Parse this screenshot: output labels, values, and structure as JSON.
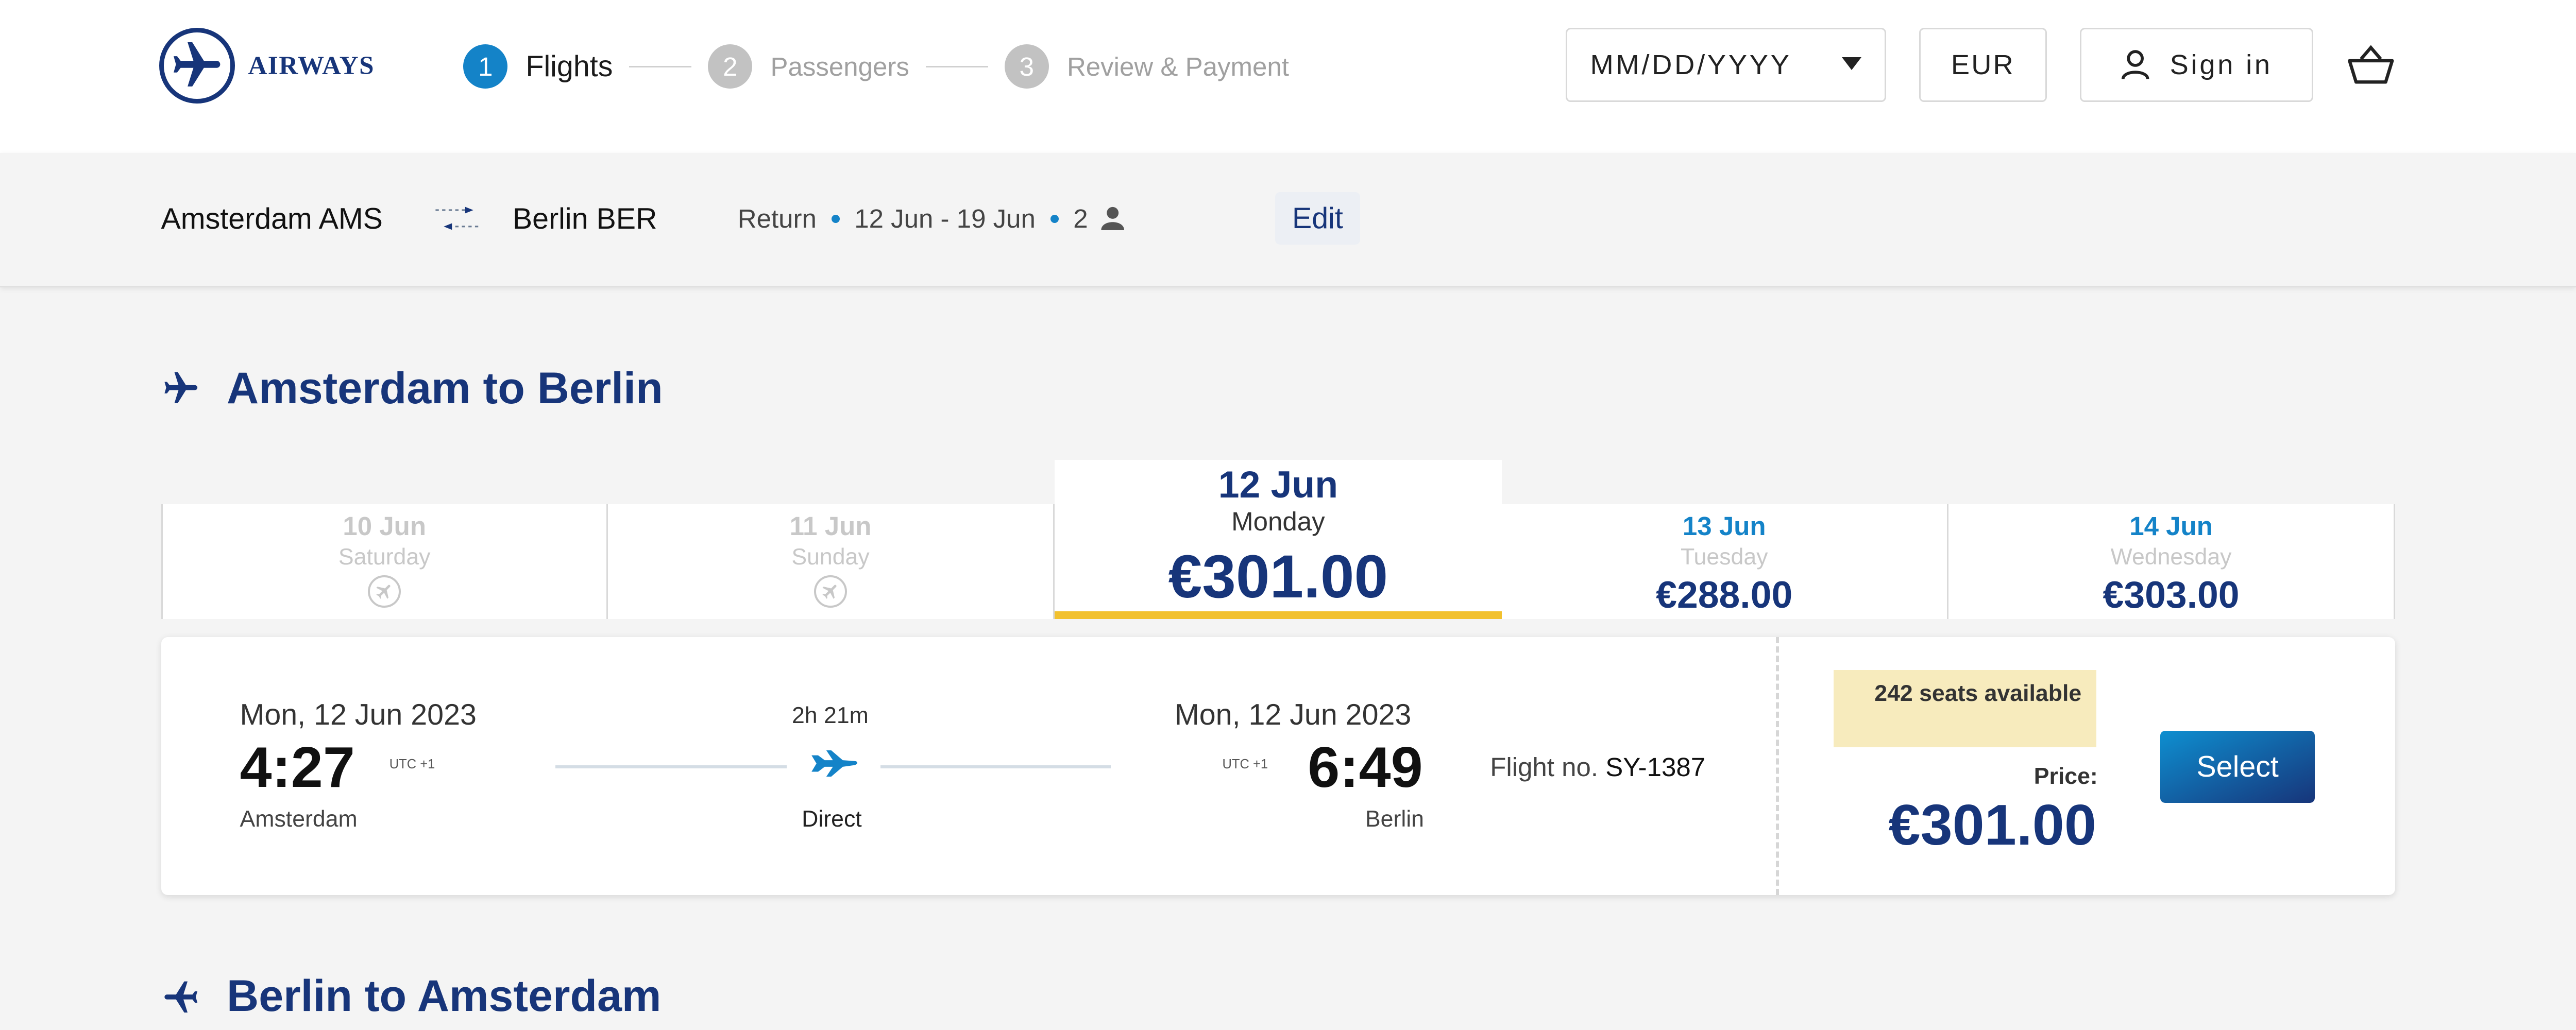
{
  "brand": {
    "name": "AIRWAYS"
  },
  "steps": [
    {
      "num": "1",
      "label": "Flights"
    },
    {
      "num": "2",
      "label": "Passengers"
    },
    {
      "num": "3",
      "label": "Review & Payment"
    }
  ],
  "header": {
    "date_placeholder": "MM/DD/YYYY",
    "currency": "EUR",
    "sign_in": "Sign in"
  },
  "search": {
    "from": "Amsterdam AMS",
    "to": "Berlin BER",
    "trip_type": "Return",
    "dates": "12 Jun - 19 Jun",
    "passengers": "2",
    "edit_label": "Edit"
  },
  "outbound": {
    "title": "Amsterdam to Berlin",
    "days": [
      {
        "date": "10 Jun",
        "weekday": "Saturday",
        "price": null,
        "status": "no-flights"
      },
      {
        "date": "11 Jun",
        "weekday": "Sunday",
        "price": null,
        "status": "no-flights"
      },
      {
        "date": "12 Jun",
        "weekday": "Monday",
        "price": "€301.00",
        "status": "selected"
      },
      {
        "date": "13 Jun",
        "weekday": "Tuesday",
        "price": "€288.00",
        "status": "available"
      },
      {
        "date": "14 Jun",
        "weekday": "Wednesday",
        "price": "€303.00",
        "status": "available"
      }
    ],
    "flight": {
      "departure_date": "Mon, 12 Jun 2023",
      "departure_time": "4:27",
      "departure_utc": "UTC +1",
      "departure_city": "Amsterdam",
      "duration": "2h 21m",
      "stops": "Direct",
      "arrival_date": "Mon, 12 Jun 2023",
      "arrival_time": "6:49",
      "arrival_utc": "UTC +1",
      "arrival_city": "Berlin",
      "flight_no_label": "Flight no.",
      "flight_no": "SY-1387",
      "seats_available": "242 seats available",
      "price_label": "Price:",
      "price": "€301.00",
      "select_label": "Select"
    }
  },
  "return": {
    "title": "Berlin to Amsterdam"
  },
  "colors": {
    "brand_navy": "#17357a",
    "accent_blue": "#1483c8",
    "selected_underline": "#f2c12e",
    "seats_badge": "#f7ebbd"
  }
}
